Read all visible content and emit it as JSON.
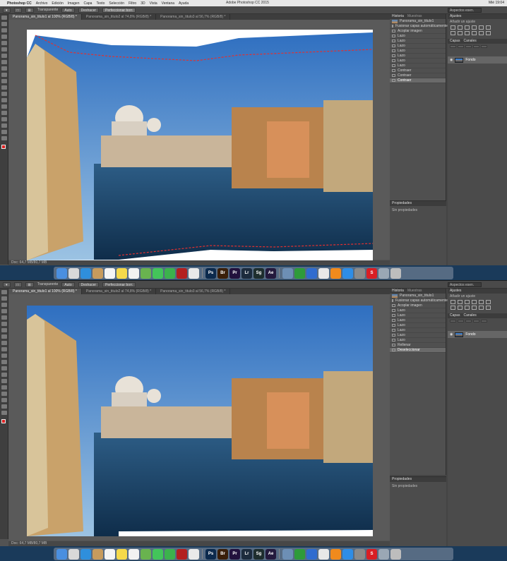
{
  "menubar": {
    "items": [
      "Photoshop CC",
      "Archivo",
      "Edición",
      "Imagen",
      "Capa",
      "Texto",
      "Selección",
      "Filtro",
      "3D",
      "Vista",
      "Ventana",
      "Ayuda"
    ],
    "title": "Adobe Photoshop CC 2015",
    "clock": "Mié 19:04"
  },
  "optionsbar": {
    "transparent_label": "Transparente",
    "mode_label": "Auto",
    "undo_label": "Deshacer",
    "confirm_label": "Perfeccionar borr.",
    "search_placeholder": "Aspectos esen."
  },
  "tabs": [
    "Panorama_sin_titulo1 al 100% (RGB/8) *",
    "Panorama_sin_titulo2 al 74,8% (RGB/8) *",
    "Panorama_sin_titulo3 al 56,7% (RGB/8) *"
  ],
  "statusbar": {
    "top": "Doc: 64,7 MB/80,7 MB",
    "bottom": "Doc: 64,7 MB/80,7 MB"
  },
  "history": {
    "tab_label": "Historia",
    "tab2_label": "Muestras",
    "snapshot": "Panorama_sin_titulo1",
    "top_items": [
      "Fusionar capas automáticamente",
      "Acoplar imagen",
      "Lazo",
      "Lazo",
      "Lazo",
      "Lazo",
      "Lazo",
      "Lazo",
      "Lazo",
      "Contraer",
      "Contraer",
      "Contraer"
    ],
    "bottom_items": [
      "Fusionar capas automáticamente",
      "Acoplar imagen",
      "Lazo",
      "Lazo",
      "Lazo",
      "Lazo",
      "Lazo",
      "Lazo",
      "Lazo",
      "Rellenar",
      "Deseleccionar"
    ]
  },
  "properties": {
    "tab_label": "Propiedades",
    "body": "Sin propiedades"
  },
  "adjustments": {
    "tab_label": "Ajustes",
    "subtitle": "Añadir un ajuste"
  },
  "layers": {
    "tab_label": "Capas",
    "tab2_label": "Canales",
    "layer_name": "Fondo"
  },
  "dock": {
    "apps": [
      {
        "name": "finder",
        "label": "",
        "color": "#4a8fe0"
      },
      {
        "name": "launchpad",
        "label": "",
        "color": "#d9d9d9"
      },
      {
        "name": "safari",
        "label": "",
        "color": "#2f8fdc"
      },
      {
        "name": "contacts",
        "label": "",
        "color": "#c79b5d"
      },
      {
        "name": "calendar",
        "label": "",
        "color": "#f4f4f4"
      },
      {
        "name": "notes",
        "label": "",
        "color": "#f5d94a"
      },
      {
        "name": "reminders",
        "label": "",
        "color": "#f2f2f2"
      },
      {
        "name": "maps",
        "label": "",
        "color": "#69b34f"
      },
      {
        "name": "messages",
        "label": "",
        "color": "#43c45a"
      },
      {
        "name": "facetime",
        "label": "",
        "color": "#3cb24c"
      },
      {
        "name": "photo-booth",
        "label": "",
        "color": "#b32020"
      },
      {
        "name": "photos",
        "label": "",
        "color": "#e9e9e9"
      },
      {
        "name": "photoshop",
        "label": "Ps",
        "color": "#0c2a4d"
      },
      {
        "name": "bridge",
        "label": "Br",
        "color": "#3a1f0a"
      },
      {
        "name": "premiere",
        "label": "Pr",
        "color": "#22113d"
      },
      {
        "name": "lightroom",
        "label": "Lr",
        "color": "#1c2b3d"
      },
      {
        "name": "speedgrade",
        "label": "Sg",
        "color": "#1e2e2e"
      },
      {
        "name": "after-effects",
        "label": "Ae",
        "color": "#241a3d"
      },
      {
        "name": "preview",
        "label": "",
        "color": "#6d8fb5"
      },
      {
        "name": "numbers",
        "label": "",
        "color": "#2e9b3a"
      },
      {
        "name": "keynote",
        "label": "",
        "color": "#2f6ccf"
      },
      {
        "name": "itunes",
        "label": "",
        "color": "#e8e8e8"
      },
      {
        "name": "ibooks",
        "label": "",
        "color": "#f08a1d"
      },
      {
        "name": "app-store",
        "label": "",
        "color": "#2e8de6"
      },
      {
        "name": "system-preferences",
        "label": "",
        "color": "#8a8a8a"
      },
      {
        "name": "red-app",
        "label": "S",
        "color": "#d91e24"
      }
    ]
  }
}
